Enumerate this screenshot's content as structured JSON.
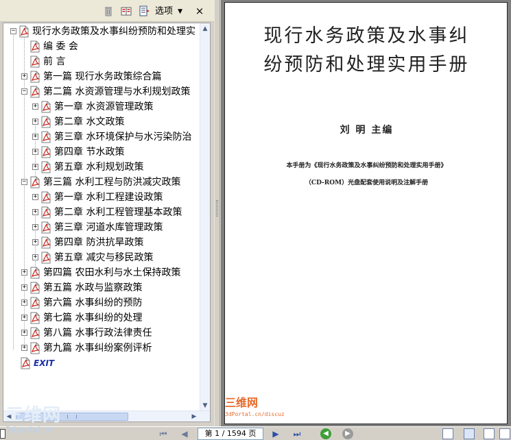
{
  "toolbar": {
    "options_label": "选项",
    "close_label": "×"
  },
  "bookmarks": [
    {
      "label": "现行水务政策及水事纠纷预防和处理实",
      "level": 0,
      "expander": "−"
    },
    {
      "label": "编 委 会",
      "level": 1,
      "expander": ""
    },
    {
      "label": "前  言",
      "level": 1,
      "expander": ""
    },
    {
      "label": "第一篇 现行水务政策综合篇",
      "level": 1,
      "expander": "+"
    },
    {
      "label": "第二篇 水资源管理与水利规划政策",
      "level": 1,
      "expander": "−"
    },
    {
      "label": "第一章 水资源管理政策",
      "level": 2,
      "expander": "+"
    },
    {
      "label": "第二章 水文政策",
      "level": 2,
      "expander": "+"
    },
    {
      "label": "第三章 水环境保护与水污染防治",
      "level": 2,
      "expander": "+"
    },
    {
      "label": "第四章 节水政策",
      "level": 2,
      "expander": "+"
    },
    {
      "label": "第五章 水利规划政策",
      "level": 2,
      "expander": "+"
    },
    {
      "label": "第三篇 水利工程与防洪减灾政策",
      "level": 1,
      "expander": "−"
    },
    {
      "label": "第一章 水利工程建设政策",
      "level": 2,
      "expander": "+"
    },
    {
      "label": "第二章 水利工程管理基本政策",
      "level": 2,
      "expander": "+"
    },
    {
      "label": "第三章 河道水库管理政策",
      "level": 2,
      "expander": "+"
    },
    {
      "label": "第四章 防洪抗旱政策",
      "level": 2,
      "expander": "+"
    },
    {
      "label": "第五章 减灾与移民政策",
      "level": 2,
      "expander": "+"
    },
    {
      "label": "第四篇 农田水利与水土保持政策",
      "level": 1,
      "expander": "+"
    },
    {
      "label": "第五篇 水政与监察政策",
      "level": 1,
      "expander": "+"
    },
    {
      "label": "第六篇 水事纠纷的预防",
      "level": 1,
      "expander": "+"
    },
    {
      "label": "第七篇 水事纠纷的处理",
      "level": 1,
      "expander": "+"
    },
    {
      "label": "第八篇 水事行政法律责任",
      "level": 1,
      "expander": "+"
    },
    {
      "label": "第九篇 水事纠纷案例评析",
      "level": 1,
      "expander": "+"
    },
    {
      "label": "EXIT",
      "level": 0,
      "expander": ""
    }
  ],
  "document": {
    "title_line1": "现行水务政策及水事纠",
    "title_line2": "纷预防和处理实用手册",
    "editor": "刘    明   主编",
    "note_line1": "本手册为《现行水务政策及水事纠纷预防和处理实用手册》",
    "note_line2": "（CD-ROM）光盘配套使用说明及注解手册",
    "watermark": "三维网",
    "watermark_sub": "3dPortal.cn/discuz"
  },
  "statusbar": {
    "page_field": "第 1 / 1594 页"
  },
  "logo_left": {
    "text": "三维网",
    "sub": "3dportal.cn"
  },
  "colors": {
    "accent_blue": "#1c2ea8",
    "pdf_red": "#c8281e",
    "watermark_orange": "#e96a2a"
  }
}
